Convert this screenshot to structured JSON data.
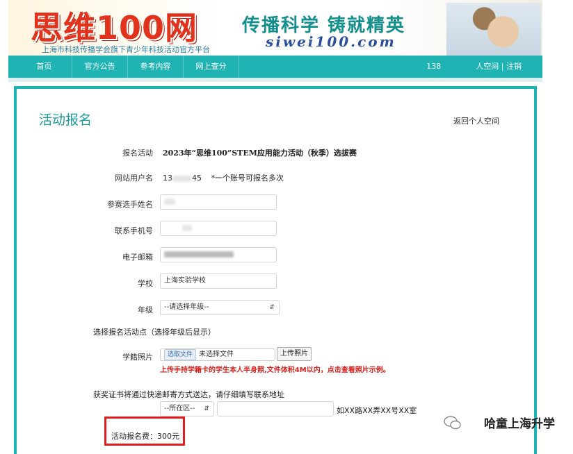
{
  "banner": {
    "logo": "思维100网",
    "logo_sub": "上海市科技传播学会旗下青少年科技活动官方平台",
    "slogan": "传播科学 铸就精英",
    "domain": "siwei100.com"
  },
  "nav": {
    "items": [
      "首页",
      "官方公告",
      "参考内容",
      "网上查分"
    ],
    "user_prefix": "138",
    "user_space": "人空间",
    "separator": "|",
    "logout": "注销"
  },
  "form": {
    "title": "活动报名",
    "back_link": "返回个人空间",
    "activity_label": "报名活动",
    "activity_value": "2023年“思维100”STEM应用能力活动（秋季）选拔赛",
    "username_label": "网站用户名",
    "username_prefix": "13",
    "username_suffix": "45",
    "username_note": "*一个账号可报名多次",
    "name_label": "参赛选手姓名",
    "phone_label": "联系手机号",
    "email_label": "电子邮箱",
    "school_label": "学校",
    "school_value": "上海实验学校",
    "grade_label": "年级",
    "grade_value": "--请选择年级--",
    "venue_label": "选择报名活动点（选择年级后显示）",
    "photo_label": "学籍照片",
    "file_button": "选取文件",
    "file_status": "未选择文件",
    "upload_button": "上传照片",
    "photo_warning": "上传手持学籍卡的学生本人半身照,文件体积4M以内，点击查看照片示例。",
    "mail_label": "获奖证书将通过快递邮寄方式送达，请仔细填写联系地址",
    "district_value": "--所在区--",
    "address_hint": "如XX路XX弄XX号XX室",
    "fee_label": "活动报名费：300元"
  },
  "watermark": "哈童上海升学",
  "colors": {
    "accent": "#1fb3b4",
    "warning": "#d8221e",
    "highlight_box": "#e11d1d"
  }
}
